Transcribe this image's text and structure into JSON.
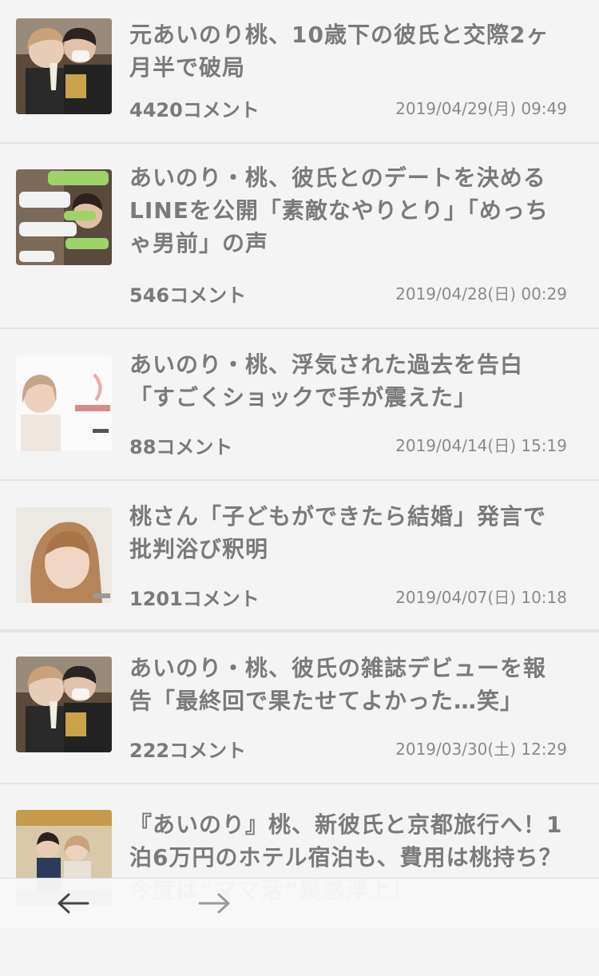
{
  "articles": [
    {
      "title": "元あいのり桃、10歳下の彼氏と交際2ヶ月半で破局",
      "comments": "4420コメント",
      "date": "2019/04/29(月) 09:49",
      "thumb": "couple-photo"
    },
    {
      "title": "あいのり・桃、彼氏とのデートを決めるLINEを公開「素敵なやりとり」「めっちゃ男前」の声",
      "comments": "546コメント",
      "date": "2019/04/28(日) 00:29",
      "thumb": "line-screenshot"
    },
    {
      "title": "あいのり・桃、浮気された過去を告白「すごくショックで手が震えた」",
      "comments": "88コメント",
      "date": "2019/04/14(日) 15:19",
      "thumb": "woman-photo"
    },
    {
      "title": "桃さん「子どもができたら結婚」発言で批判浴び釈明",
      "comments": "1201コメント",
      "date": "2019/04/07(日) 10:18",
      "thumb": "woman-portrait"
    },
    {
      "title": "あいのり・桃、彼氏の雑誌デビューを報告「最終回で果たせてよかった…笑」",
      "comments": "222コメント",
      "date": "2019/03/30(土) 12:29",
      "thumb": "couple-photo"
    },
    {
      "title": "『あいのり』桃、新彼氏と京都旅行へ！1泊6万円のホテル宿泊も、費用は桃持ち？今度は“ママ活”疑惑浮上！",
      "comments": "",
      "date": "",
      "thumb": "couple-room"
    }
  ],
  "nav": {
    "back_icon": "arrow-left-icon",
    "forward_icon": "arrow-right-icon"
  }
}
